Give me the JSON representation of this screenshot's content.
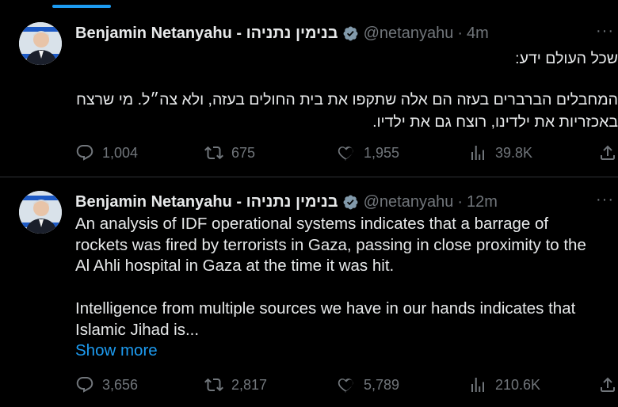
{
  "colors": {
    "accent": "#1d9bf0",
    "muted": "#71767b",
    "text": "#e7e9ea",
    "background": "#000000",
    "divider": "#2f3336"
  },
  "more_label": "···",
  "tweets": [
    {
      "author_name": "Benjamin Netanyahu - בנימין נתניהו",
      "handle": "@netanyahu",
      "separator": "·",
      "time": "4m",
      "verified_icon": "verified-badge-icon",
      "text_rtl_1": "שכל העולם ידע:",
      "text_rtl_2": "המחבלים הברברים בעזה הם אלה שתקפו את בית החולים בעזה, ולא צה״ל. מי שרצח באכזריות את ילדינו, רוצח גם את ילדיו.",
      "stats": {
        "replies": "1,004",
        "reposts": "675",
        "likes": "1,955",
        "views": "39.8K"
      }
    },
    {
      "author_name": "Benjamin Netanyahu - בנימין נתניהו",
      "handle": "@netanyahu",
      "separator": "·",
      "time": "12m",
      "verified_icon": "verified-badge-icon",
      "text_p1": "An analysis of IDF operational systems indicates that a barrage of rockets was fired by terrorists in Gaza, passing in close proximity to the Al Ahli hospital in Gaza at the time it was hit.",
      "text_p2": "Intelligence from multiple sources we have in our hands indicates that Islamic Jihad is...",
      "show_more": "Show more",
      "stats": {
        "replies": "3,656",
        "reposts": "2,817",
        "likes": "5,789",
        "views": "210.6K"
      }
    }
  ]
}
